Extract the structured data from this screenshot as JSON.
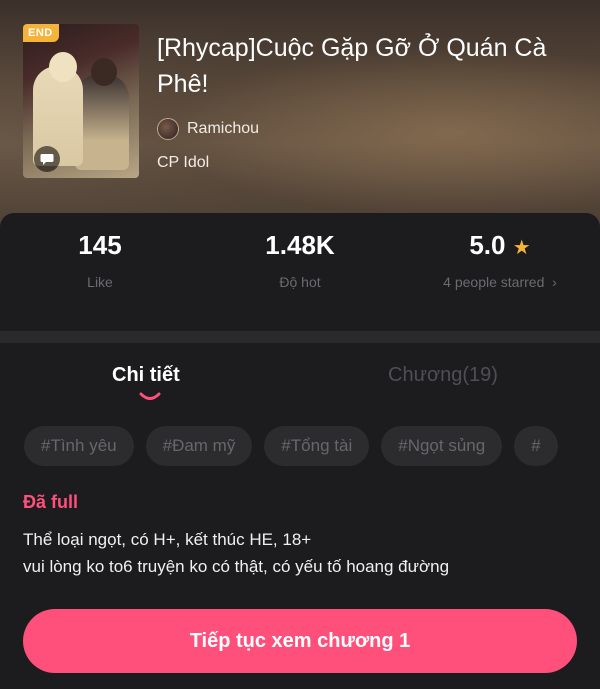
{
  "book": {
    "badge": "END",
    "title": "[Rhycap]Cuộc Gặp Gỡ Ở Quán Cà Phê!",
    "author": "Ramichou",
    "category": "CP Idol"
  },
  "stats": {
    "likes": {
      "value": "145",
      "label": "Like"
    },
    "hot": {
      "value": "1.48K",
      "label": "Độ hot"
    },
    "rating": {
      "value": "5.0",
      "label": "4 people starred",
      "star_color": "#f6b33a"
    }
  },
  "tabs": {
    "detail": "Chi tiết",
    "chapters": "Chương(19)"
  },
  "tags": [
    "#Tình yêu",
    "#Đam mỹ",
    "#Tổng tài",
    "#Ngọt sủng",
    "#"
  ],
  "detail": {
    "status": "Đã full",
    "line1": "Thể loại ngọt, có H+, kết thúc HE, 18+",
    "line2": "vui lòng ko to6 truyện ko có thật, có yếu tố hoang đường"
  },
  "cta": {
    "label": "Tiếp tục xem chương 1"
  },
  "colors": {
    "accent": "#ff4f7b",
    "badge": "#f6b33a",
    "background": "#1c1c1e"
  }
}
